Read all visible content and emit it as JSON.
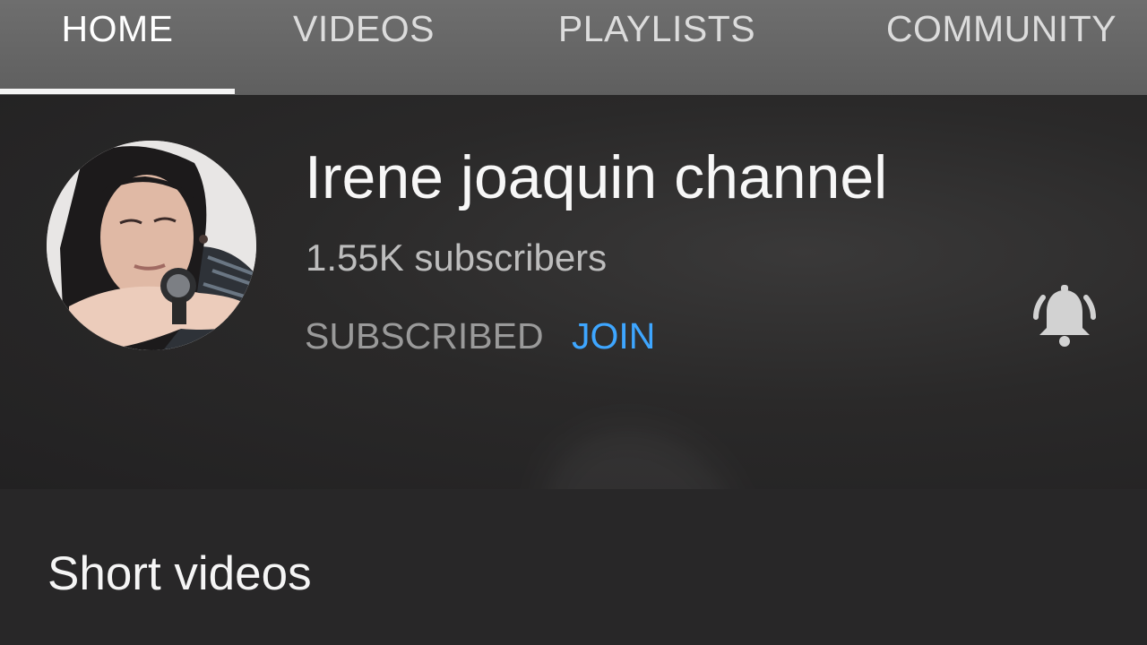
{
  "tabs": [
    {
      "label": "HOME",
      "active": true
    },
    {
      "label": "VIDEOS",
      "active": false
    },
    {
      "label": "PLAYLISTS",
      "active": false
    },
    {
      "label": "COMMUNITY",
      "active": false
    }
  ],
  "channel": {
    "name": "Irene joaquin channel",
    "subscribers": "1.55K subscribers",
    "subscribed_label": "SUBSCRIBED",
    "join_label": "JOIN",
    "notification_icon": "bell-icon",
    "avatar_icon": "channel-avatar"
  },
  "section": {
    "title": "Short videos"
  },
  "colors": {
    "tab_bar": "#666666",
    "background": "#242324",
    "join": "#3ea6ff",
    "subscribed": "#9a9a9a"
  }
}
